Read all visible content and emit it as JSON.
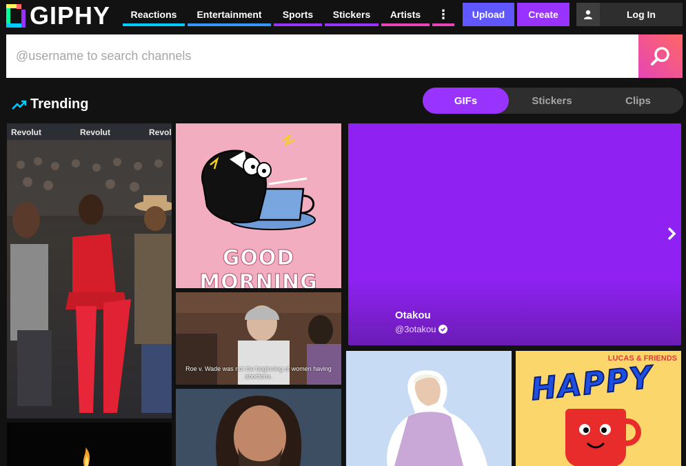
{
  "header": {
    "logo_text": "GIPHY",
    "nav": [
      {
        "label": "Reactions",
        "bar": "#00ccff",
        "width": 90
      },
      {
        "label": "Entertainment",
        "bar": "#3399ff",
        "width": 121
      },
      {
        "label": "Sports",
        "bar": "#9933ff",
        "width": 70
      },
      {
        "label": "Stickers",
        "bar": "#9933ff",
        "width": 78
      },
      {
        "label": "Artists",
        "bar": "#e646b6",
        "width": 70
      }
    ],
    "more_label": "⋮",
    "upload_label": "Upload",
    "create_label": "Create",
    "login_label": "Log In"
  },
  "search": {
    "placeholder": "@username to search channels"
  },
  "trending": {
    "title": "Trending"
  },
  "tabs": [
    {
      "label": "GIFs",
      "active": true
    },
    {
      "label": "Stickers",
      "active": false
    },
    {
      "label": "Clips",
      "active": false
    }
  ],
  "tiles": {
    "crowd_signs": [
      "Revolut",
      "Revolut",
      "Revolu"
    ],
    "morning_text": "GOOD MORNING",
    "caption": "Roe v. Wade was not the beginning of women having abortions.",
    "channel_name": "Otakou",
    "channel_handle": "@3otakou",
    "happy_text": "HAPPY",
    "lucas_text": "LUCAS & FRIENDS"
  },
  "colors": {
    "accent_purple": "#9933ff",
    "upload_blue": "#6157ff",
    "background": "#121212"
  }
}
